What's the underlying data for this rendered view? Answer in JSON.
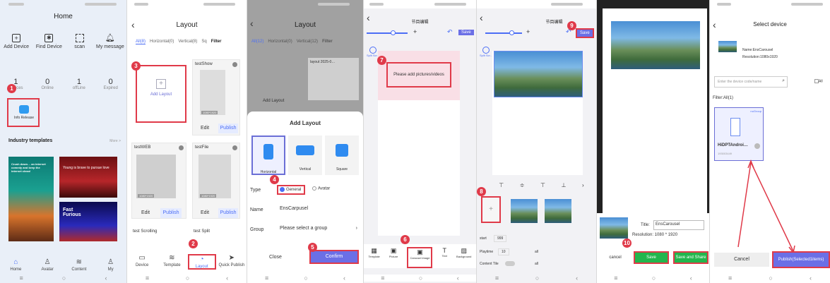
{
  "p1": {
    "title": "Home",
    "actions": [
      "Add Device",
      "Find Device",
      "scan",
      "My message"
    ],
    "stats": [
      {
        "v": "1",
        "l": "devices"
      },
      {
        "v": "0",
        "l": "Online"
      },
      {
        "v": "1",
        "l": "offLine"
      },
      {
        "v": "0",
        "l": "Expired"
      }
    ],
    "info_release": "Info Release",
    "industry": "Industry templates",
    "more": "More >",
    "tmpl1": "Crush down… an internet comedy and keep the internet clean!",
    "tmpl2": "Young is brave to pursue love",
    "tmpl3": "Fast Furious",
    "tabs": [
      "Home",
      "Avatar",
      "Content",
      "My"
    ]
  },
  "p2": {
    "title": "Layout",
    "tabs": [
      "All(8)",
      "Horizontal(0)",
      "Vertical(8)",
      "Sq",
      "Filter"
    ],
    "add_layout": "Add Layout",
    "cards": [
      "testShow",
      "testWEB",
      "testFile",
      "test Scrolling",
      "test Split"
    ],
    "res": "1080*1920",
    "edit": "Edit",
    "publish": "Publish",
    "bottom": [
      "Device",
      "Template",
      "Layout",
      "Quick Publish"
    ]
  },
  "p3": {
    "title": "Layout",
    "tabs": [
      "All(12)",
      "Horizontal(0)",
      "Vertical(12)",
      "Filter"
    ],
    "layout_card": "layout 2025-0…",
    "add_layout": "Add Layout",
    "dlg_title": "Add Layout",
    "orient": [
      "Horizontal",
      "Vertical",
      "Square"
    ],
    "type_label": "Type",
    "type_opts": [
      "General",
      "Avatar"
    ],
    "name_label": "Name",
    "name_value": "EnsCarpusel",
    "group_label": "Group",
    "group_ph": "Please select a group",
    "close": "Close",
    "confirm": "Confirm"
  },
  "p4": {
    "title": "节目编辑",
    "save": "Save",
    "split": "Split Scr…",
    "add_media": "Please add pictures/videos",
    "tools": [
      "Template",
      "Picture",
      "Carousel image",
      "Text",
      "Background"
    ]
  },
  "p5": {
    "title": "节目编辑",
    "save": "Save",
    "split": "Split Scr…",
    "start": "start",
    "start_v": "999",
    "playtime": "Playtime",
    "playtime_v": "10",
    "content_title": "Content Tile",
    "all": "all"
  },
  "p6": {
    "title_label": "Title:",
    "title_value": "EnsCarousel",
    "res": "Resolution: 1080 * 1920",
    "cancel": "cancel",
    "save": "Save",
    "save_share": "Save and Share"
  },
  "p7": {
    "title": "Select device",
    "dev_name": "Name:EnsCarousel",
    "dev_res": "Resolution:1080x1920",
    "search_ph": "Enter the device code/name",
    "all": "All",
    "filter": "Filter:All(1)",
    "group_tag": "noGroup",
    "dev_card": "HiDPTAndroi…",
    "dev_code": "193003449",
    "cancel": "Cancel",
    "publish": "Publish(Selected1items)"
  },
  "markers": [
    "1",
    "2",
    "3",
    "4",
    "5",
    "6",
    "7",
    "8",
    "9",
    "10"
  ],
  "colors": {
    "accent": "#5b7cf5",
    "red": "#e03a49",
    "green": "#23b64d"
  }
}
